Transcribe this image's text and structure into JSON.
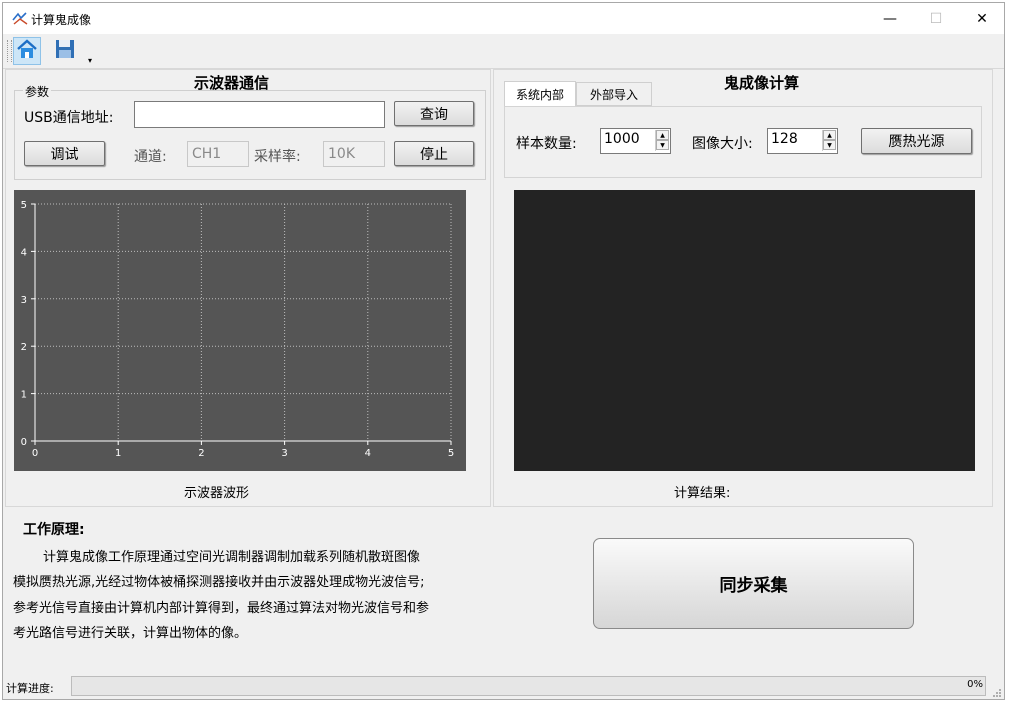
{
  "window": {
    "title": "计算鬼成像",
    "minimize": "—",
    "maximize": "☐",
    "close": "✕"
  },
  "toolbar": {
    "home_icon": "home-icon",
    "save_icon": "save-icon",
    "dropdown": "▾"
  },
  "left": {
    "heading": "示波器通信",
    "group_title": "参数",
    "usb_label": "USB通信地址:",
    "usb_value": "",
    "query_button": "查询",
    "debug_button": "调试",
    "channel_label": "通道:",
    "channel_value": "CH1",
    "rate_label": "采样率:",
    "rate_value": "10K",
    "stop_button": "停止",
    "plot_caption": "示波器波形",
    "plot": {
      "x_ticks": [
        "0",
        "1",
        "2",
        "3",
        "4",
        "5"
      ],
      "y_ticks": [
        "0",
        "1",
        "2",
        "3",
        "4",
        "5"
      ]
    }
  },
  "right": {
    "heading": "鬼成像计算",
    "tabs": [
      "系统内部",
      "外部导入"
    ],
    "sample_label": "样本数量:",
    "sample_value": "1000",
    "image_size_label": "图像大小:",
    "image_size_value": "128",
    "source_button": "赝热光源",
    "result_caption": "计算结果:"
  },
  "description": {
    "title": "工作原理:",
    "lines": [
      "计算鬼成像工作原理通过空间光调制器调制加载系列随机散斑图像",
      "模拟赝热光源,光经过物体被桶探测器接收并由示波器处理成物光波信号;",
      "参考光信号直接由计算机内部计算得到，最终通过算法对物光波信号和参",
      "考光路信号进行关联，计算出物体的像。"
    ]
  },
  "sync_button": "同步采集",
  "status": {
    "progress_label": "计算进度:",
    "progress_value": 0,
    "progress_text": "0%"
  },
  "colors": {
    "plot_bg": "#555555",
    "result_bg": "#232323",
    "window_bg": "#f0f0f0"
  }
}
